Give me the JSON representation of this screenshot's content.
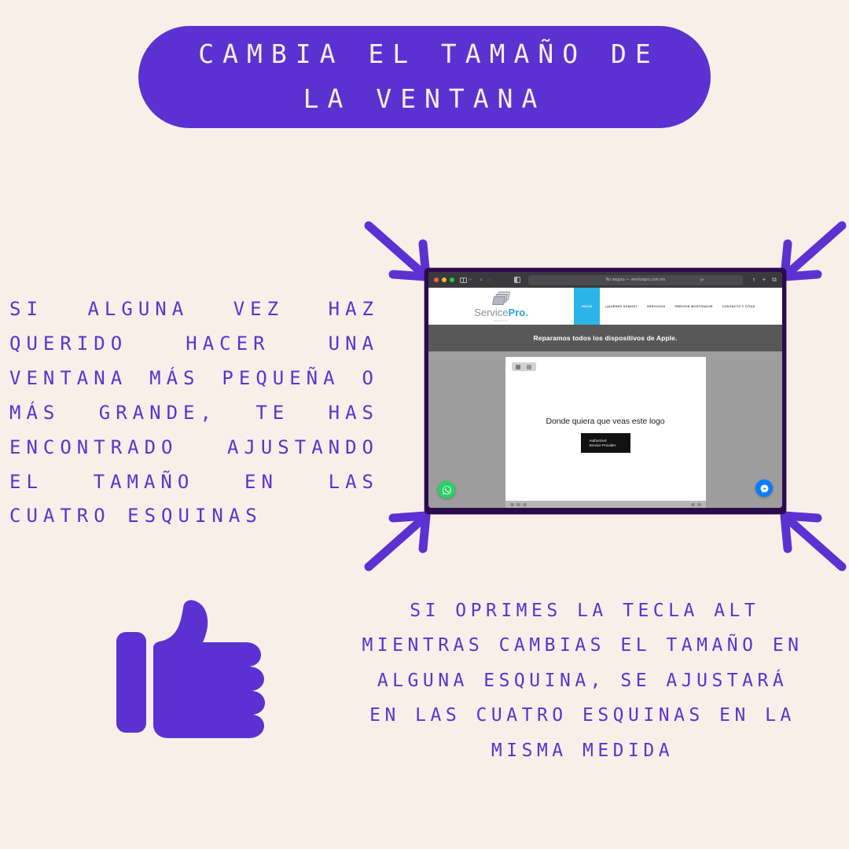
{
  "theme": {
    "background": "#f9efe9",
    "accent_purple": "#5b32d1",
    "bezel_purple": "#2b0a4d",
    "title_text_color": "#f6eee9"
  },
  "title": {
    "text": "CAMBIA EL TAMAÑO DE LA VENTANA"
  },
  "left_paragraph": {
    "text": "SI ALGUNA VEZ HAZ QUERIDO HACER UNA VENTANA MÁS PEQUEÑA O MÁS GRANDE, TE HAS ENCONTRADO AJUSTANDO EL TAMAÑO EN LAS CUATRO ESQUINAS"
  },
  "bottom_paragraph": {
    "text": "SI OPRIMES LA TECLA ALT MIENTRAS CAMBIAS EL TAMAÑO EN ALGUNA ESQUINA, SE AJUSTARÁ EN LAS CUATRO ESQUINAS EN LA MISMA MEDIDA"
  },
  "arrows": [
    {
      "name": "arrow-top-left",
      "direction": "down-right"
    },
    {
      "name": "arrow-top-right",
      "direction": "down-left"
    },
    {
      "name": "arrow-bottom-left",
      "direction": "up-right"
    },
    {
      "name": "arrow-bottom-right",
      "direction": "up-left"
    }
  ],
  "browser": {
    "toolbar": {
      "traffic_lights": [
        "close",
        "minimize",
        "zoom"
      ],
      "sidebar_icon": "sidebar-icon",
      "back_label": "‹",
      "forward_label": "›",
      "reader_icon": "reader-view-icon",
      "url_text": "No seguro — servicepro.com.mx",
      "reload_label": "⟳",
      "share_label": "↑",
      "new_tab_label": "+",
      "tabs_label": "⧉"
    },
    "site": {
      "logo": {
        "word_primary": "Service",
        "word_accent": "Pro.",
        "subtitle": "MEXICO"
      },
      "nav_items": [
        {
          "label": "INICIO",
          "active": true
        },
        {
          "label": "¿QUIÉNES SOMOS?",
          "active": false
        },
        {
          "label": "SERVICIOS",
          "active": false
        },
        {
          "label": "PRECIOS MOSTRADOR",
          "active": false
        },
        {
          "label": "CONTACTO Y CITAS",
          "active": false
        }
      ],
      "banner_text": "Reparamos todos los dispositivos de Apple.",
      "content": {
        "heading": "Donde quiera que veas este logo",
        "badge": {
          "apple_glyph": "",
          "line1": "Authorized",
          "line2": "Service Provider"
        }
      },
      "floating_buttons": [
        {
          "name": "whatsapp-button",
          "color": "#25d366"
        },
        {
          "name": "messenger-button",
          "color": "#0a7cff"
        }
      ]
    }
  },
  "thumbs_up": {
    "name": "thumbs-up-icon",
    "color": "#5b32d1"
  }
}
